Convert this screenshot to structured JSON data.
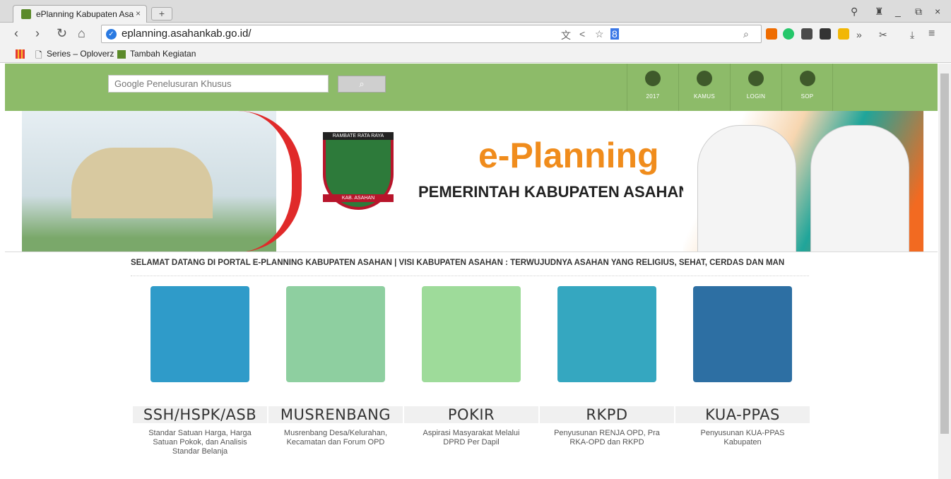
{
  "browser": {
    "tab_title": "ePlanning Kabupaten Asa",
    "tab_close": "×",
    "new_tab": "+",
    "window_controls": [
      "_",
      "⧉",
      "×"
    ],
    "url": "eplanning.asahankab.go.id/",
    "bookmarks": [
      "Series – Oploverz",
      "Tambah Kegiatan"
    ]
  },
  "search": {
    "placeholder": "Google Penelusuran Khusus",
    "button_icon": "search-icon"
  },
  "header_nav": [
    {
      "label": "2017",
      "icon": "sprout-icon"
    },
    {
      "label": "KAMUS",
      "icon": "compass-icon"
    },
    {
      "label": "LOGIN",
      "icon": "user-icon"
    },
    {
      "label": "SOP",
      "icon": "chat-icon"
    }
  ],
  "banner": {
    "logo_caption": "RAMBATE RATA RAYA",
    "logo_bottom": "KAB. ASAHAN",
    "title": "e-Planning",
    "subtitle": "PEMERINTAH KABUPATEN ASAHAN"
  },
  "marquee": "SELAMAT DATANG DI PORTAL E-PLANNING KABUPATEN ASAHAN | VISI KABUPATEN ASAHAN : TERWUJUDNYA ASAHAN YANG RELIGIUS, SEHAT, CERDAS DAN MAN",
  "modules": [
    {
      "title": "SSH/HSPK/ASB",
      "desc": "Standar Satuan Harga, Harga Satuan Pokok, dan Analisis Standar Belanja",
      "color": "#2f9bc9"
    },
    {
      "title": "MUSRENBANG",
      "desc": "Musrenbang Desa/Kelurahan, Kecamatan dan Forum OPD",
      "color": "#8ecfa0"
    },
    {
      "title": "POKIR",
      "desc": "Aspirasi Masyarakat Melalui DPRD Per Dapil",
      "color": "#9edb9a"
    },
    {
      "title": "RKPD",
      "desc": "Penyusunan RENJA OPD, Pra RKA-OPD dan RKPD",
      "color": "#35a7c0"
    },
    {
      "title": "KUA-PPAS",
      "desc": "Penyusunan KUA-PPAS Kabupaten",
      "color": "#2d6fa3"
    }
  ]
}
